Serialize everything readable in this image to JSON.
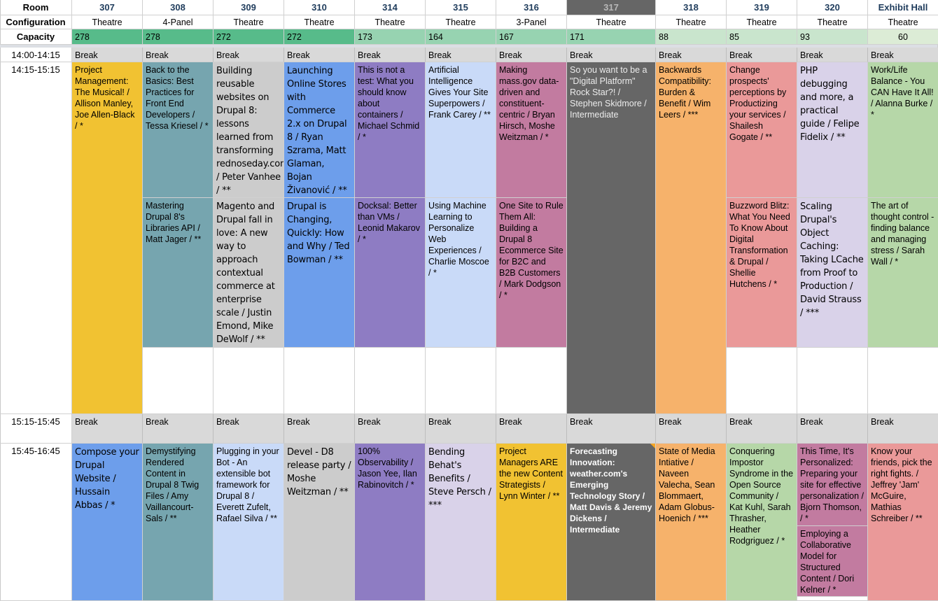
{
  "header": {
    "room_label": "Room",
    "configuration_label": "Configuration",
    "capacity_label": "Capacity"
  },
  "rooms": [
    {
      "room": "307",
      "configuration": "Theatre",
      "capacity": "278"
    },
    {
      "room": "308",
      "configuration": "4-Panel",
      "capacity": "278"
    },
    {
      "room": "309",
      "configuration": "Theatre",
      "capacity": "272"
    },
    {
      "room": "310",
      "configuration": "Theatre",
      "capacity": "272"
    },
    {
      "room": "314",
      "configuration": "Theatre",
      "capacity": "173"
    },
    {
      "room": "315",
      "configuration": "Theatre",
      "capacity": "164"
    },
    {
      "room": "316",
      "configuration": "3-Panel",
      "capacity": "167"
    },
    {
      "room": "317",
      "configuration": "Theatre",
      "capacity": "171"
    },
    {
      "room": "318",
      "configuration": "Theatre",
      "capacity": "88"
    },
    {
      "room": "319",
      "configuration": "Theatre",
      "capacity": "85"
    },
    {
      "room": "320",
      "configuration": "Theatre",
      "capacity": "93"
    },
    {
      "room": "Exhibit Hall",
      "configuration": "Theatre",
      "capacity": "60"
    }
  ],
  "timeslots": [
    {
      "label": "14:00-14:15"
    },
    {
      "label": "14:15-15:15"
    },
    {
      "label": "15:15-15:45"
    },
    {
      "label": "15:45-16:45"
    }
  ],
  "break_label": "Break",
  "sessions_1415": {
    "r307": "Project Management: The Musical! / Allison Manley, Joe Allen-Black / *",
    "r308a": "Back to the Basics: Best Practices for Front End Developers / Tessa Kriesel / *",
    "r308b": "Mastering Drupal 8's Libraries API / Matt Jager / **",
    "r309a": "Building reusable websites on Drupal 8: lessons learned from transforming rednoseday.com / Peter Vanhee / **",
    "r309b": "Magento and Drupal fall in love: A new way to approach contextual commerce at enterprise scale / Justin Emond, Mike DeWolf / **",
    "r310a": "Launching Online Stores with Commerce 2.x on Drupal 8 / Ryan Szrama, Matt Glaman, Bojan Živanović / **",
    "r310b": "Drupal is Changing, Quickly: How and Why / Ted Bowman / **",
    "r314a": "This is not a test: What you should know about containers / Michael Schmid / *",
    "r314b": "Docksal: Better than VMs / Leonid Makarov / *",
    "r315a": "Artificial Intelligence Gives Your Site Superpowers / Frank Carey / **",
    "r315b": "Using Machine Learning to Personalize Web Experiences / Charlie Moscoe / *",
    "r316a": "Making mass.gov data-driven and constituent-centric / Bryan Hirsch, Moshe Weitzman / *",
    "r316b": "One Site to Rule Them All: Building a Drupal 8 Ecommerce Site for B2C and B2B Customers / Mark Dodgson / *",
    "r317": "So you want to be a \"Digital Platform\" Rock Star?! / Stephen Skidmore / Intermediate",
    "r318": "Backwards Compatibility: Burden & Benefit / Wim Leers / ***",
    "r319a": "Change prospects' perceptions by Productizing your services / Shailesh Gogate / **",
    "r319b": "Buzzword Blitz: What You Need To Know About Digital Transformation & Drupal / Shellie Hutchens / *",
    "r320a": "PHP debugging and more, a practical guide / Felipe Fidelix / **",
    "r320b": "Scaling Drupal's Object Caching: Taking LCache from Proof to Production / David Strauss / ***",
    "rexa": "Work/Life Balance - You CAN Have It All! / Alanna Burke / *",
    "rexb": "The art of thought control - finding balance and managing stress / Sarah Wall / *"
  },
  "sessions_1545": {
    "r307": "Compose your Drupal Website / Hussain Abbas / *",
    "r308": "Demystifying Rendered Content in Drupal 8 Twig Files / Amy Vaillancourt-Sals / **",
    "r309": "Plugging in your Bot - An extensible bot framework for Drupal 8 / Everett Zufelt, Rafael Silva / **",
    "r310": "Devel - D8 release party / Moshe Weitzman / **",
    "r314": "100% Observability / Jason Yee, Ilan Rabinovitch / *",
    "r315": "Bending Behat's Benefits / Steve Persch / ***",
    "r316": "Project Managers ARE the new Content Strategists / Lynn Winter / **",
    "r317": "Forecasting Innovation: weather.com's Emerging Technology Story / Matt Davis & Jeremy Dickens / Intermediate",
    "r318": "State of Media Intiative / Naveen Valecha, Sean Blommaert, Adam Globus-Hoenich / ***",
    "r319": "Conquering Impostor Syndrome in the Open Source Community / Kat Kuhl, Sarah Thrasher, Heather Rodgriguez / *",
    "r320a": "This Time, It's Personalized: Preparing your site for effective personalization / Bjorn Thomson, / *",
    "r320b": "Employing a Collaborative Model for Structured Content / Dori Kelner / *",
    "rexh": "Know your friends, pick the right fights. / Jeffrey 'Jam' McGuire, Mathias Schreiber / **"
  },
  "colors": {
    "capacity_high": "#57bb8a",
    "capacity_mid": "#97d3b1",
    "capacity_low": "#c9e5cd",
    "break": "#d9d9d9",
    "room_317_header": "#666666",
    "comment_marker": "#f6a623"
  }
}
